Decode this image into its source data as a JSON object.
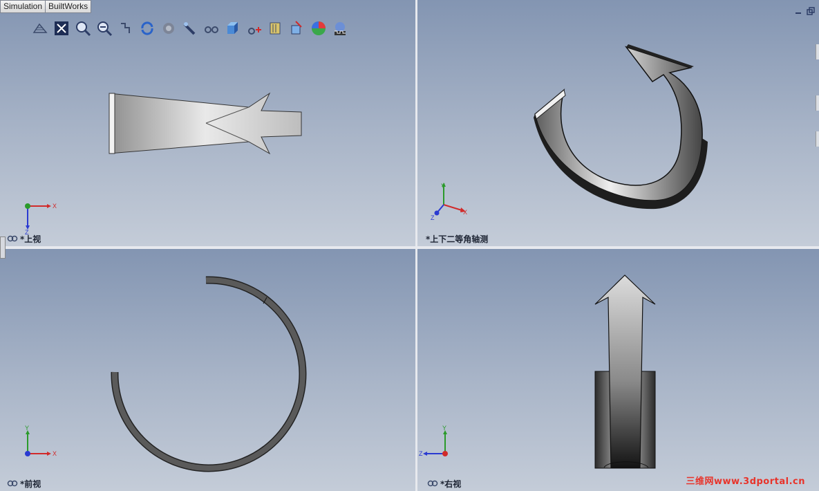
{
  "tabs": [
    {
      "label": "Simulation"
    },
    {
      "label": "BuiltWorks"
    }
  ],
  "toolbar": {
    "icons": [
      "previous-view-icon",
      "zoom-to-fit-icon",
      "zoom-to-area-icon",
      "zoom-in-out-icon",
      "rotate-view-icon",
      "rebuild-icon",
      "graphics-quality-icon",
      "section-view-icon",
      "view-orientation-glasses-icon",
      "display-style-cube-icon",
      "hide-show-items-icon",
      "edit-appearance-icon",
      "apply-scene-icon",
      "view-settings-icon",
      "render-tools-icon"
    ]
  },
  "viewports": {
    "top_left": {
      "label": "*上视",
      "triad": {
        "x": "X",
        "y": "",
        "z": "Z"
      }
    },
    "top_right": {
      "label": "*上下二等角轴测",
      "triad": {
        "x": "X",
        "y": "Y",
        "z": "Z"
      }
    },
    "bottom_left": {
      "label": "*前视",
      "triad": {
        "x": "X",
        "y": "Y",
        "z": ""
      }
    },
    "bottom_right": {
      "label": "*右视",
      "triad": {
        "x": "",
        "y": "Y",
        "z": "Z"
      }
    }
  },
  "watermark": "三维网www.3dportal.cn",
  "colors": {
    "axis_x": "#d12a2a",
    "axis_y": "#2a9a2a",
    "axis_z": "#2a3ad1",
    "viewport_top": "#8395b2",
    "viewport_bottom": "#c4ccd8",
    "watermark": "#e8332a"
  }
}
